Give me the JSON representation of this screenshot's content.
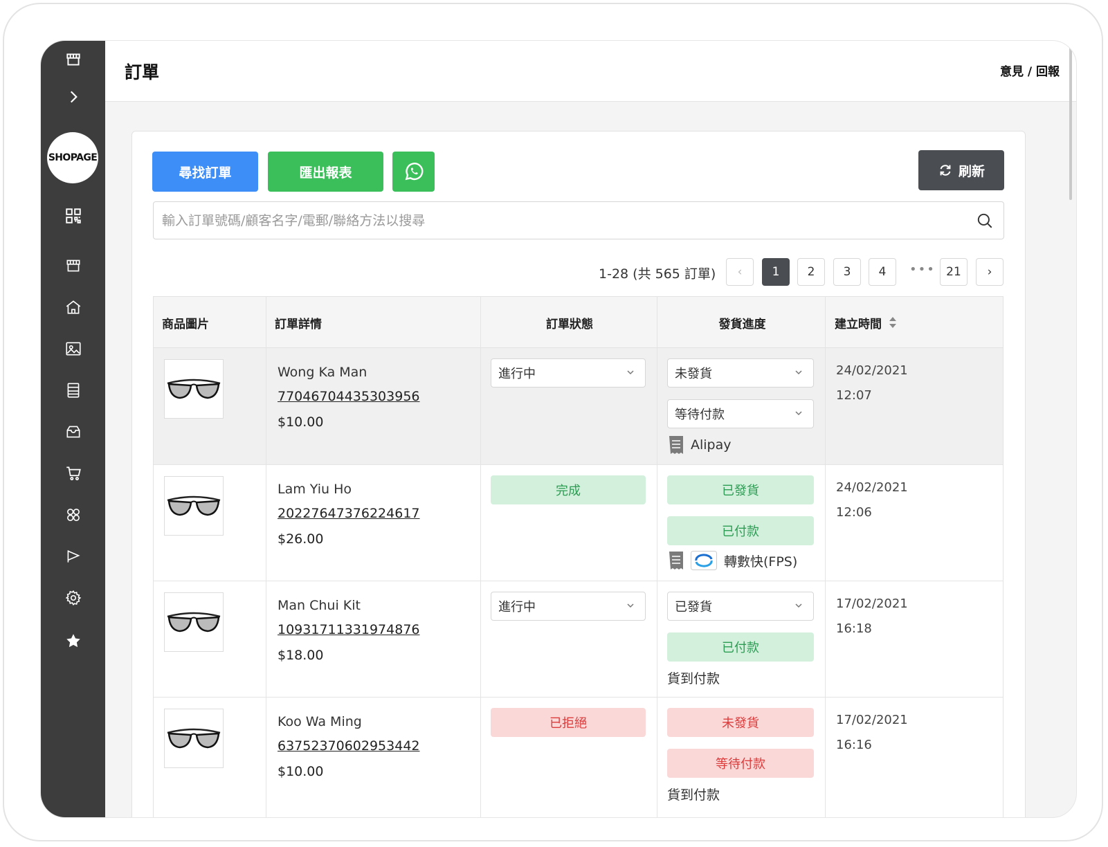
{
  "brand": {
    "logo_text": "SHOPAGE"
  },
  "header": {
    "title": "訂單",
    "feedback": "意見 / 回報"
  },
  "toolbar": {
    "find_label": "尋找訂單",
    "export_label": "匯出報表",
    "refresh_label": "刷新"
  },
  "search": {
    "placeholder": "輸入訂單號碼/顧客名字/電郵/聯絡方法以搜尋",
    "value": ""
  },
  "pagination": {
    "summary": "1-28 (共 565 訂單)",
    "pages": [
      "1",
      "2",
      "3",
      "4",
      "21"
    ],
    "current": "1",
    "ellipsis": "•••",
    "prev": "‹",
    "next": "›"
  },
  "table": {
    "columns": [
      "商品圖片",
      "訂單詳情",
      "訂單狀態",
      "發貨進度",
      "建立時間"
    ],
    "rows": [
      {
        "name": "Wong Ka Man",
        "order_no": "77046704435303956",
        "price": "$10.00",
        "status": "進行中",
        "shipping": "未發貨",
        "payment": "等待付款",
        "method": "Alipay",
        "date": "24/02/2021",
        "time": "12:07"
      },
      {
        "name": "Lam Yiu Ho",
        "order_no": "20227647376224617",
        "price": "$26.00",
        "status": "完成",
        "shipping": "已發貨",
        "payment": "已付款",
        "method": "轉數快(FPS)",
        "date": "24/02/2021",
        "time": "12:06"
      },
      {
        "name": "Man Chui Kit",
        "order_no": "10931711331974876",
        "price": "$18.00",
        "status": "進行中",
        "shipping": "已發貨",
        "payment": "已付款",
        "method": "貨到付款",
        "date": "17/02/2021",
        "time": "16:18"
      },
      {
        "name": "Koo Wa Ming",
        "order_no": "63752370602953442",
        "price": "$10.00",
        "status": "已拒絕",
        "shipping": "未發貨",
        "payment": "等待付款",
        "method": "貨到付款",
        "date": "17/02/2021",
        "time": "16:16"
      }
    ]
  },
  "colors": {
    "sidebar": "#3d3d3d",
    "primary_blue": "#3d8ef6",
    "green": "#3bbf5b",
    "dark_button": "#4a4d52",
    "success_tag_bg": "#d2f0dc",
    "success_tag_text": "#2c9c53",
    "danger_tag_bg": "#fbd8d8",
    "danger_tag_text": "#dc3b3b"
  },
  "icons": {
    "sidebar": [
      "store-icon",
      "chevron-right-icon",
      "qr-code-icon",
      "store-icon",
      "home-icon",
      "image-icon",
      "document-icon",
      "inbox-icon",
      "cart-icon",
      "apps-icon",
      "megaphone-icon",
      "gear-icon",
      "star-icon"
    ],
    "toolbar": [
      "whatsapp-icon",
      "refresh-icon",
      "search-icon"
    ]
  }
}
